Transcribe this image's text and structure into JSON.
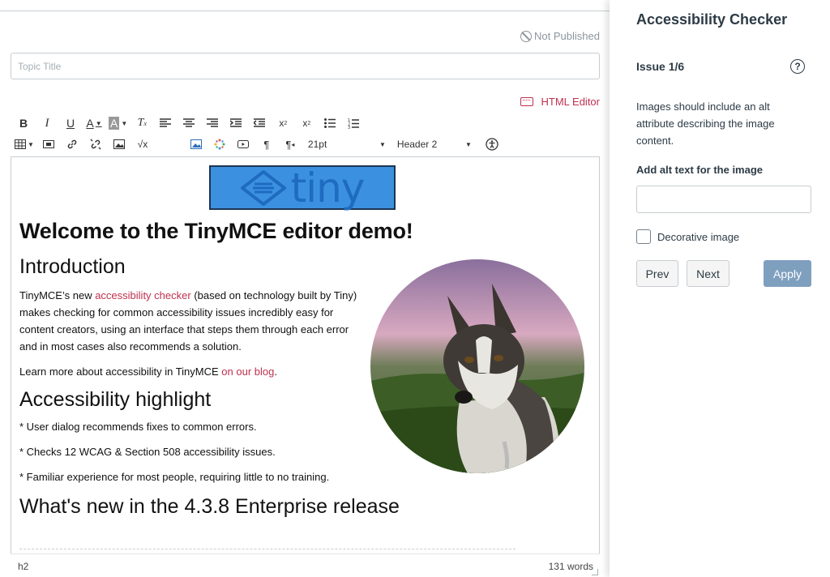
{
  "header": {
    "status": "Not Published"
  },
  "topic": {
    "placeholder": "Topic Title"
  },
  "toolbar": {
    "html_editor_label": "HTML Editor",
    "font_size": "21pt",
    "block_format": "Header 2"
  },
  "editor": {
    "logo_text": "tiny",
    "heading": "Welcome to the TinyMCE editor demo!",
    "intro_heading": "Introduction",
    "intro_p1_before": "TinyMCE’s new ",
    "intro_p1_link": "accessibility checker",
    "intro_p1_after": " (based on technology built by Tiny) makes checking for common accessibility issues incredibly easy for content creators, using an interface that steps them through each error and in most cases also recommends a solution.",
    "intro_p2_before": "Learn more about accessibility in TinyMCE ",
    "intro_p2_link": "on our blog",
    "intro_p2_after": ".",
    "highlight_heading": "Accessibility highlight",
    "bullets": [
      "* User dialog recommends fixes to common errors.",
      "* Checks 12 WCAG & Section 508 accessibility issues.",
      "* Familiar experience for most people, requiring little to no training."
    ],
    "release_heading": "What's new in the 4.3.8 Enterprise release"
  },
  "statusbar": {
    "path": "h2",
    "word_count": "131 words"
  },
  "checker": {
    "title": "Accessibility Checker",
    "issue": "Issue 1/6",
    "help_symbol": "?",
    "message": "Images should include an alt attribute describing the image content.",
    "field_label": "Add alt text for the image",
    "alt_value": "",
    "decorative_label": "Decorative image",
    "prev_label": "Prev",
    "next_label": "Next",
    "apply_label": "Apply"
  },
  "colors": {
    "accent": "#bf3150",
    "apply_button": "#7f9fbf",
    "logo_bg": "#3b91e0"
  }
}
